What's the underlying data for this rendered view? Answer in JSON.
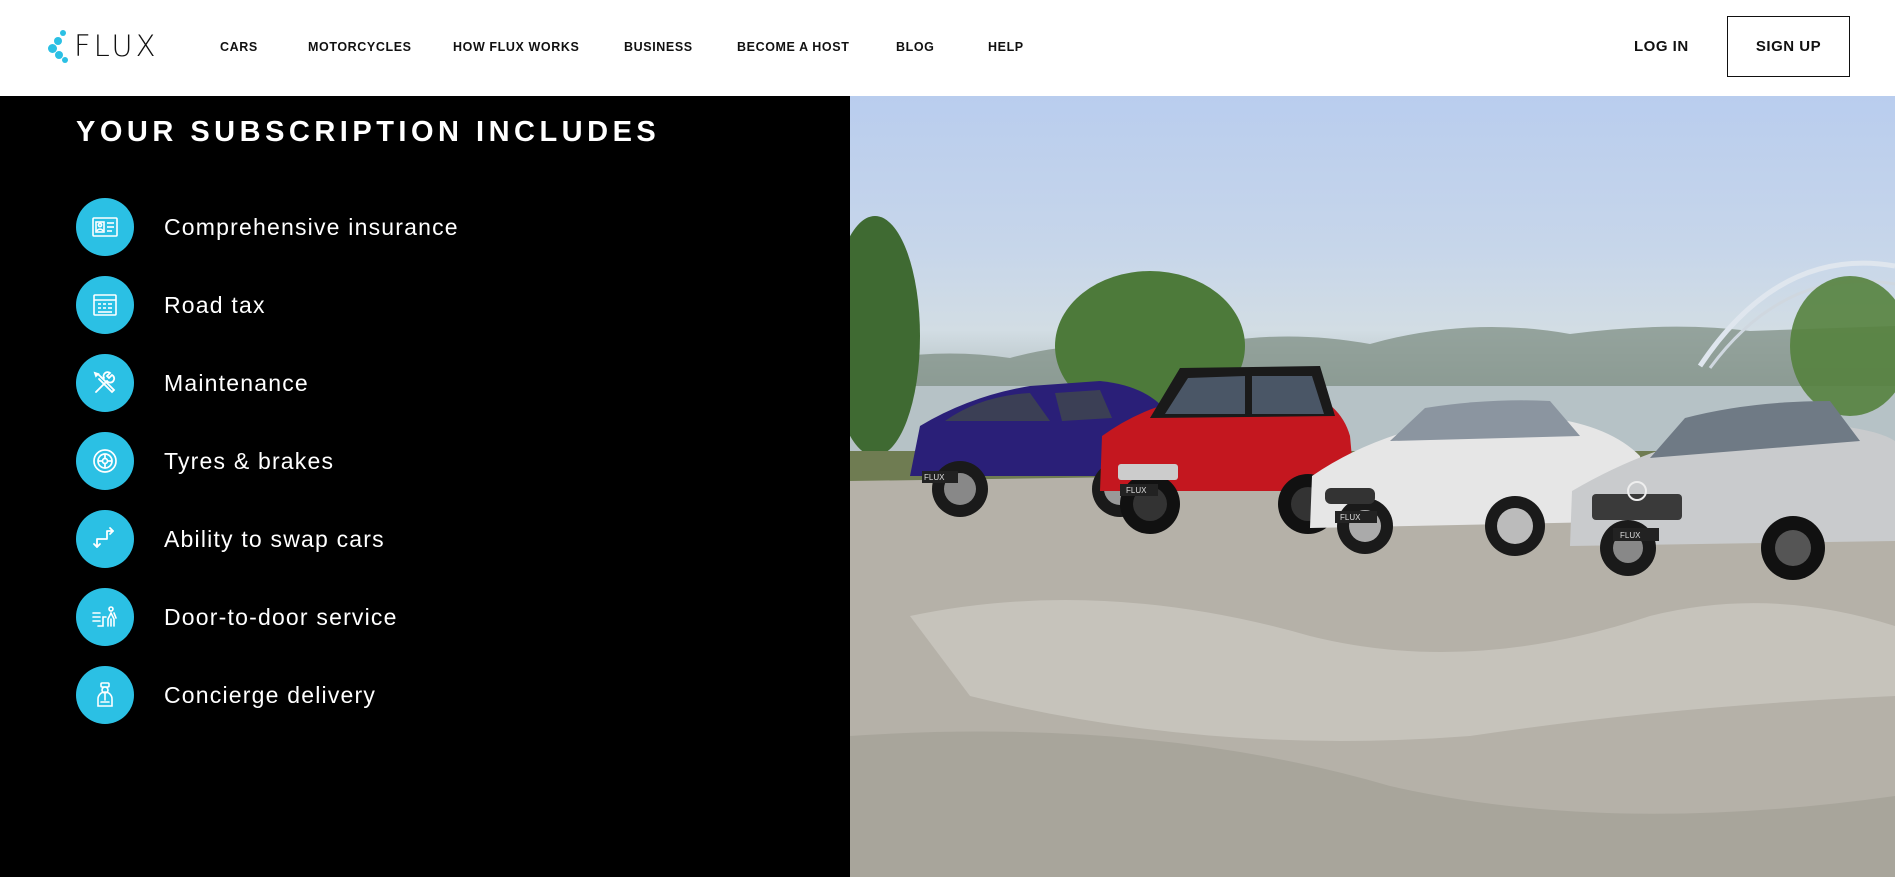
{
  "brand": {
    "name": "FLUX",
    "accent_color": "#2bc0e4"
  },
  "nav": {
    "items": [
      {
        "label": "CARS"
      },
      {
        "label": "MOTORCYCLES"
      },
      {
        "label": "HOW FLUX WORKS"
      },
      {
        "label": "BUSINESS"
      },
      {
        "label": "BECOME A HOST"
      },
      {
        "label": "BLOG"
      },
      {
        "label": "HELP"
      }
    ],
    "login_label": "LOG IN",
    "signup_label": "SIGN UP"
  },
  "subscription": {
    "title": "YOUR SUBSCRIPTION INCLUDES",
    "features": [
      {
        "label": "Comprehensive insurance",
        "icon": "insurance-card-icon"
      },
      {
        "label": "Road tax",
        "icon": "road-tax-document-icon"
      },
      {
        "label": "Maintenance",
        "icon": "wrench-screwdriver-icon"
      },
      {
        "label": "Tyres & brakes",
        "icon": "tyre-icon"
      },
      {
        "label": "Ability to swap cars",
        "icon": "swap-arrows-icon"
      },
      {
        "label": "Door-to-door service",
        "icon": "door-to-door-icon"
      },
      {
        "label": "Concierge delivery",
        "icon": "concierge-icon"
      }
    ]
  },
  "hero_image": {
    "plate_text": "FLUX"
  }
}
